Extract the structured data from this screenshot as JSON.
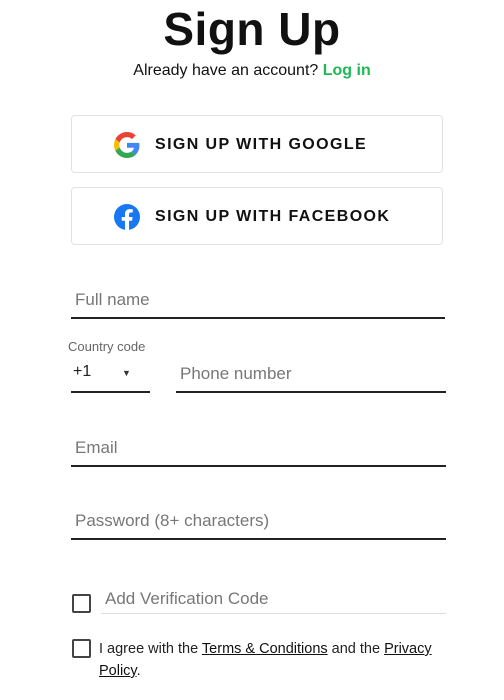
{
  "header": {
    "title": "Sign Up",
    "have_account_text": "Already have an account?",
    "login_link": "Log in"
  },
  "social": {
    "google_label": "SIGN UP WITH GOOGLE",
    "facebook_label": "SIGN UP WITH FACEBOOK",
    "google_icon": "google-icon",
    "facebook_icon": "facebook-icon"
  },
  "form": {
    "full_name": {
      "value": "",
      "placeholder": "Full name"
    },
    "country_code": {
      "label": "Country code",
      "value": "+1"
    },
    "phone": {
      "value": "",
      "placeholder": "Phone number"
    },
    "email": {
      "value": "",
      "placeholder": "Email"
    },
    "password": {
      "value": "",
      "placeholder": "Password (8+ characters)"
    },
    "verification": {
      "value": "",
      "placeholder": "Add Verification Code",
      "checked": false
    }
  },
  "terms": {
    "checked": false,
    "prefix": "I agree with the ",
    "terms_link": "Terms & Conditions",
    "middle": " and the ",
    "privacy_link": "Privacy Policy",
    "suffix": "."
  },
  "colors": {
    "accent_green": "#1db954",
    "facebook_blue": "#1877f2"
  }
}
